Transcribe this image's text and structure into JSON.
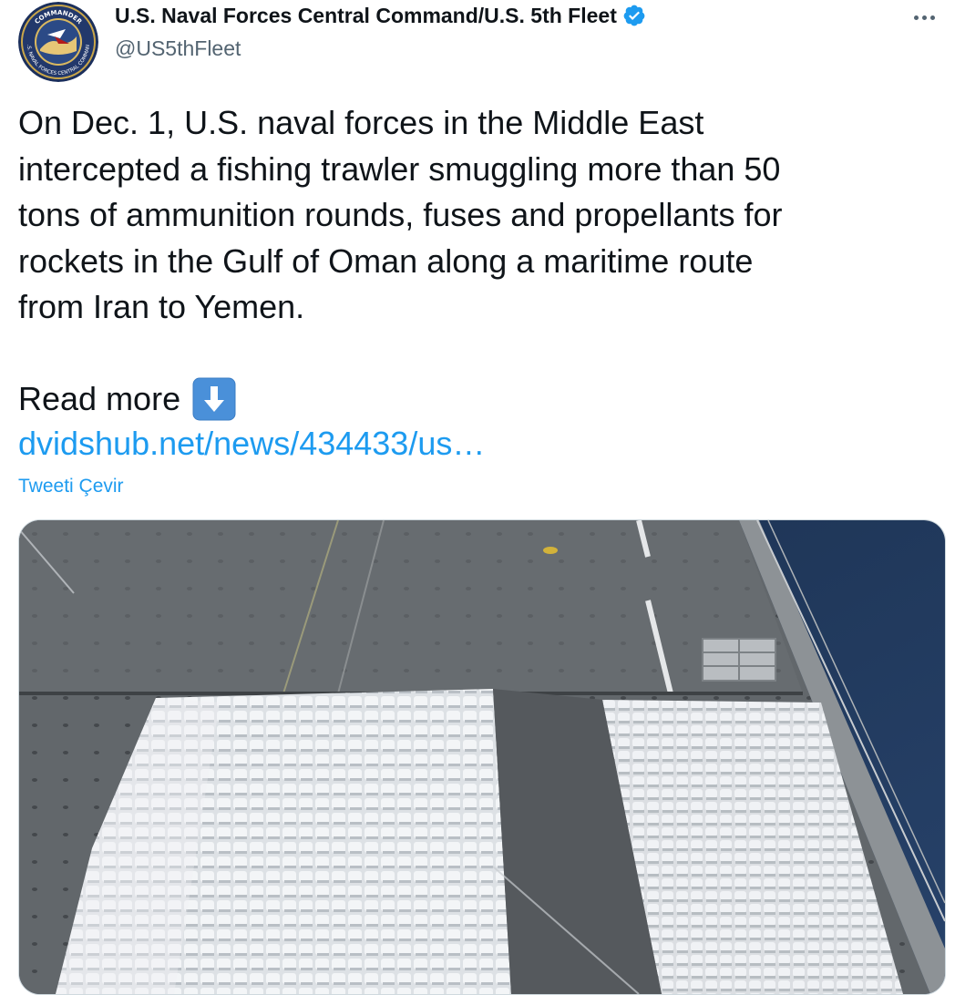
{
  "tweet": {
    "author": {
      "display_name": "U.S. Naval Forces Central Command/U.S. 5th Fleet",
      "handle": "@US5thFleet",
      "verified": true,
      "avatar_icon": "naval-command-seal-icon",
      "avatar_text_top": "COMMANDER",
      "avatar_text_bottom": "U.S. NAVAL FORCES CENTRAL COMMAND"
    },
    "more_icon": "more-horizontal-icon",
    "text": "On Dec. 1, U.S. naval forces in the Middle East\nintercepted a fishing trawler smuggling more than 50\ntons of ammunition rounds, fuses and propellants for\nrockets in the Gulf of Oman along a maritime route\nfrom Iran to Yemen.",
    "read_more_label": "Read more",
    "read_more_icon": "down-arrow-emoji-icon",
    "link_text": "dvidshub.net/news/434433/us…",
    "translate_label": "Tweeti Çevir",
    "media": {
      "type": "photo",
      "icon": "ship-deck-photo"
    }
  },
  "colors": {
    "text": "#0f1419",
    "secondary": "#536471",
    "accent": "#1d9bf0",
    "border": "#cfd9de",
    "deck": "#5d6266",
    "water": "#1e3552",
    "bags": "#e9ecef"
  }
}
